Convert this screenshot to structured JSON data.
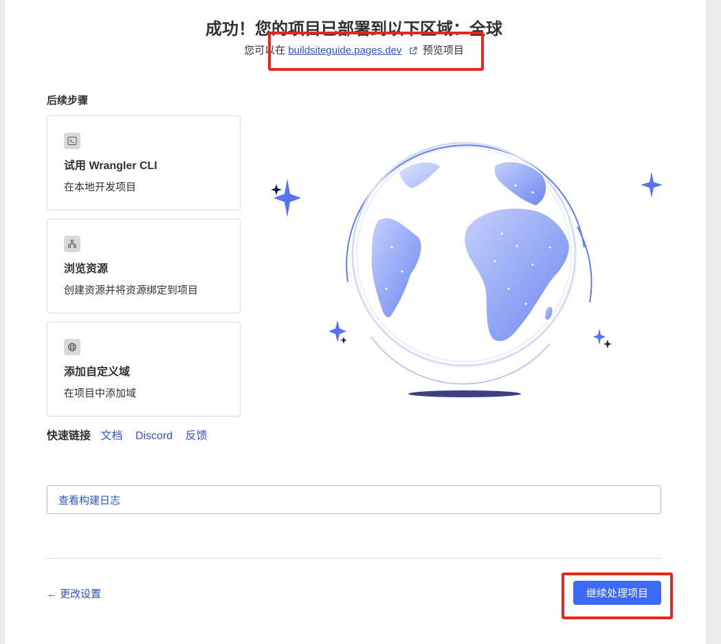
{
  "header": {
    "title": "成功！您的项目已部署到以下区域：全球",
    "prefix": "您可以在",
    "link": "buildsiteguide.pages.dev",
    "link_icon": "external-link-icon",
    "suffix": "预览项目"
  },
  "next_steps": {
    "label": "后续步骤",
    "items": [
      {
        "icon": "terminal-icon",
        "title": "试用 Wrangler CLI",
        "desc": "在本地开发项目"
      },
      {
        "icon": "resources-icon",
        "title": "浏览资源",
        "desc": "创建资源并将资源绑定到项目"
      },
      {
        "icon": "globe-icon",
        "title": "添加自定义域",
        "desc": "在项目中添加域"
      }
    ]
  },
  "quick_links": {
    "label": "快速链接",
    "links": [
      "文档",
      "Discord",
      "反馈"
    ]
  },
  "build_log": {
    "label": "查看构建日志"
  },
  "footer": {
    "back_label": "← 更改设置",
    "continue_label": "继续处理项目"
  },
  "colors": {
    "accent": "#3c6af6",
    "link": "#2c53c3",
    "highlight": "#e8261d",
    "globe_fill": "#7e97f5"
  }
}
